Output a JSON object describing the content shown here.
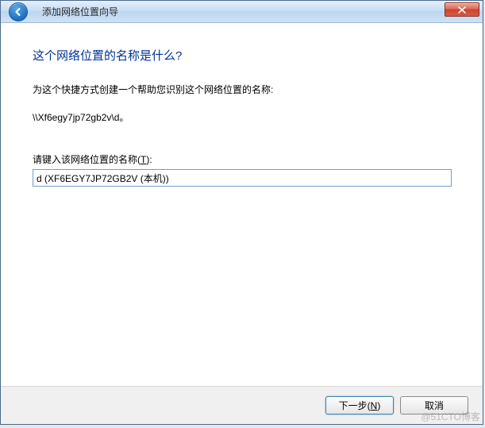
{
  "window": {
    "title": "添加网络位置向导"
  },
  "content": {
    "heading": "这个网络位置的名称是什么?",
    "instruction": "为这个快捷方式创建一个帮助您识别这个网络位置的名称:",
    "path": "\\\\Xf6egy7jp72gb2v\\d。",
    "input_label_prefix": "请键入该网络位置的名称(",
    "input_label_accel": "T",
    "input_label_suffix": "):",
    "input_value": "d (XF6EGY7JP72GB2V (本机))"
  },
  "footer": {
    "next_prefix": "下一步(",
    "next_accel": "N",
    "next_suffix": ")",
    "cancel": "取消"
  },
  "watermark": "@51CTO博客"
}
